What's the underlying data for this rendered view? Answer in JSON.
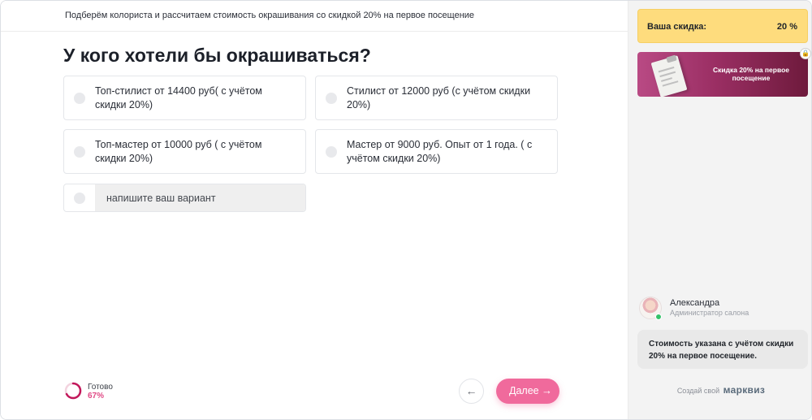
{
  "header": {
    "text": "Подберём колориста и рассчитаем стоимость окрашивания со скидкой 20% на первое посещение"
  },
  "question": {
    "title": "У кого хотели бы окрашиваться?",
    "options": [
      {
        "label": "Топ-стилист от 14400 руб( с учётом скидки 20%)"
      },
      {
        "label": "Стилист от 12000 руб (с учётом скидки 20%)"
      },
      {
        "label": "Топ-мастер от 10000 руб ( с учётом скидки 20%)"
      },
      {
        "label": "Мастер от 9000 руб. Опыт от 1 года. ( с учётом скидки 20%)"
      }
    ],
    "custom_placeholder": "напишите ваш вариант"
  },
  "footer": {
    "progress_label": "Готово",
    "progress_value": "67%",
    "progress_fraction": 0.67,
    "back_icon": "arrow-left-icon",
    "next_label": "Далее",
    "next_icon": "arrow-right-icon",
    "accent_color": "#f06a9c"
  },
  "sidebar": {
    "discount_label": "Ваша скидка:",
    "discount_value": "20 %",
    "promo_text": "Скидка 20% на первое посещение",
    "manager": {
      "name": "Александра",
      "role": "Администратор салона"
    },
    "message": "Стоимость указана с учётом скидки 20% на первое посещение.",
    "made_with_prefix": "Создай свой",
    "brand": "марквиз"
  }
}
